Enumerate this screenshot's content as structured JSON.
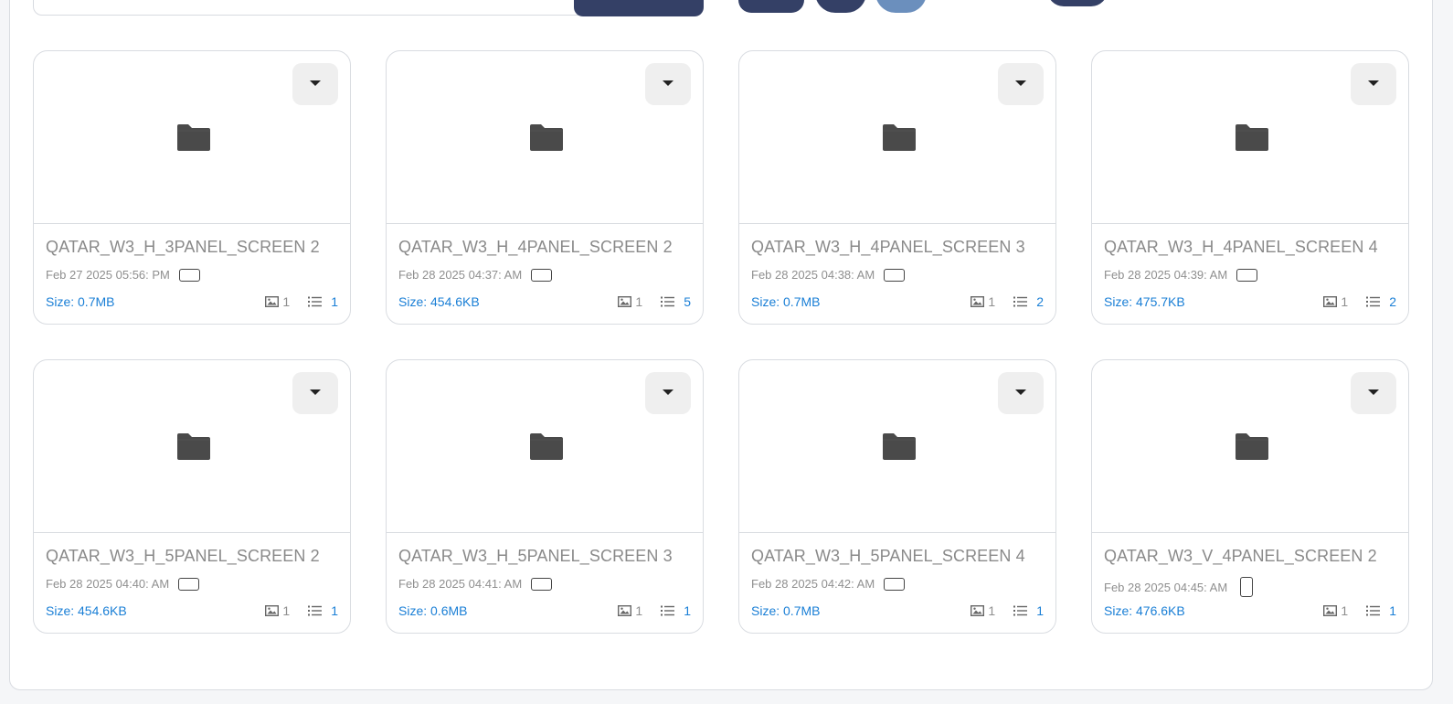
{
  "cards": [
    {
      "name": "QATAR_W3_H_3PANEL_SCREEN 2",
      "date": "Feb 27 2025 05:56: PM",
      "orientation": "landscape",
      "size": "Size: 0.7MB",
      "images": "1",
      "items": "1"
    },
    {
      "name": "QATAR_W3_H_4PANEL_SCREEN 2",
      "date": "Feb 28 2025 04:37: AM",
      "orientation": "landscape",
      "size": "Size: 454.6KB",
      "images": "1",
      "items": "5"
    },
    {
      "name": "QATAR_W3_H_4PANEL_SCREEN 3",
      "date": "Feb 28 2025 04:38: AM",
      "orientation": "landscape",
      "size": "Size: 0.7MB",
      "images": "1",
      "items": "2"
    },
    {
      "name": "QATAR_W3_H_4PANEL_SCREEN 4",
      "date": "Feb 28 2025 04:39: AM",
      "orientation": "landscape",
      "size": "Size: 475.7KB",
      "images": "1",
      "items": "2"
    },
    {
      "name": "QATAR_W3_H_5PANEL_SCREEN 2",
      "date": "Feb 28 2025 04:40: AM",
      "orientation": "landscape",
      "size": "Size: 454.6KB",
      "images": "1",
      "items": "1"
    },
    {
      "name": "QATAR_W3_H_5PANEL_SCREEN 3",
      "date": "Feb 28 2025 04:41: AM",
      "orientation": "landscape",
      "size": "Size: 0.6MB",
      "images": "1",
      "items": "1"
    },
    {
      "name": "QATAR_W3_H_5PANEL_SCREEN 4",
      "date": "Feb 28 2025 04:42: AM",
      "orientation": "landscape",
      "size": "Size: 0.7MB",
      "images": "1",
      "items": "1"
    },
    {
      "name": "QATAR_W3_V_4PANEL_SCREEN 2",
      "date": "Feb 28 2025 04:45: AM",
      "orientation": "portrait",
      "size": "Size: 476.6KB",
      "images": "1",
      "items": "1"
    }
  ],
  "icons": {
    "thumbnail": "folder-icon",
    "menu": "caret-down-icon",
    "orientation": "screen-orientation-icon",
    "images": "image-icon",
    "items": "list-icon"
  },
  "colors": {
    "accent": "#1a7fd6",
    "primary_button": "#344066",
    "folder": "#4a4a4a"
  }
}
